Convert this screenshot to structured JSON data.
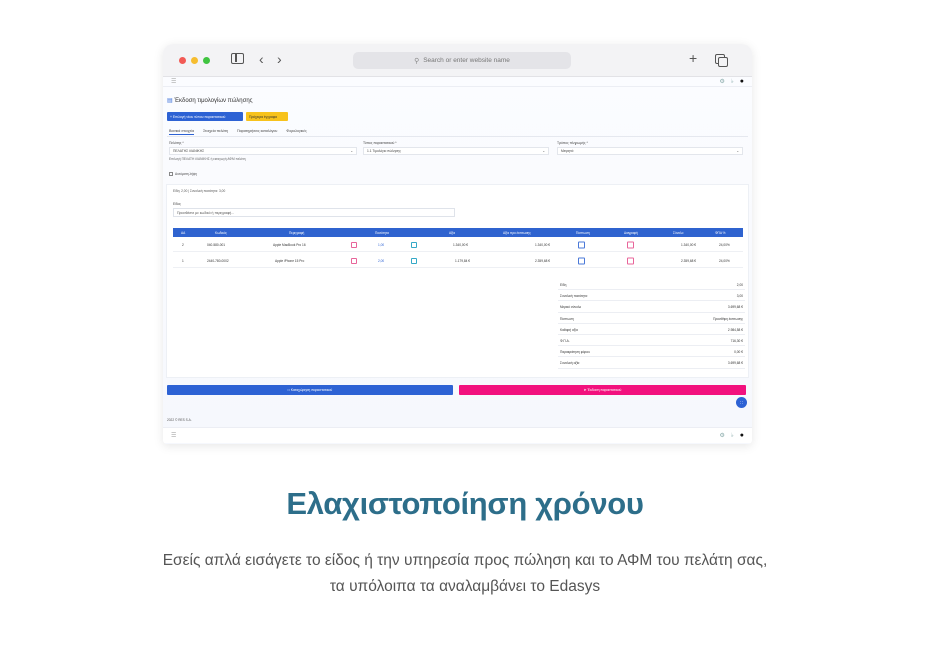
{
  "browser": {
    "url_placeholder": "Search or enter website name",
    "icons": [
      "sidebar-icon",
      "back-icon",
      "forward-icon",
      "search-icon",
      "plus-icon",
      "tabs-icon"
    ]
  },
  "app": {
    "page_title": "Έκδοση τιμολογίων πώλησης",
    "buttons": {
      "primary": "+ Επιλογή νέου τύπου παραστατικού",
      "secondary": "Πρόχειρα έγγραφα"
    },
    "tabs": [
      "Βασικά στοιχεία",
      "Στοιχεία πελάτη",
      "Παρατηρήσεις καταλόγου",
      "Φορολογικές"
    ],
    "fields": [
      {
        "label": "Πελάτης *",
        "value": "ΠΕΛΑΤΗΣ ΛΙΑΝΙΚΗΣ"
      },
      {
        "label": "Τύπος παραστατικού *",
        "value": "1.1 Τιμολόγιο πώλησης"
      },
      {
        "label": "Τρόπος πληρωμής *",
        "value": "Μετρητά"
      }
    ],
    "customer_hint": "Επιλογή ΠΕΛΑΤΗ ΛΙΑΝΙΚΗΣ ή εισαγωγή ΑΦΜ πελάτη",
    "checkbox_label": "Αυτόματη λήψη",
    "totals_line": "Είδη: 2,00 | Συνολική ποσότητα: 3,00",
    "items_label": "Είδος",
    "items_placeholder": "Προσθέστε με κωδικό ή περιγραφή...",
    "table": {
      "headers": [
        "ΑΑ",
        "Κωδικός",
        "Περιγραφή",
        "Ποσότητα",
        "Αξία",
        "Αξία προ έκπτωσης",
        "Έκπτωση",
        "Διαγραφή",
        "Σύνολο",
        "ΦΠΑ %"
      ],
      "rows": [
        {
          "aa": "2",
          "code": "040-580-001",
          "desc": "Apple MacBook Pro 16",
          "qty": "1,00",
          "value": "1.340,00 €",
          "pre": "1.340,00 €",
          "total": "1.340,00 €",
          "vat": "24,00%"
        },
        {
          "aa": "1",
          "code": "2440-780-0002",
          "desc": "Apple iPhone 15 Pro",
          "qty": "2,00",
          "value": "1.179,84 €",
          "pre": "2.359,68 €",
          "total": "2.359,68 €",
          "vat": "24,00%"
        }
      ]
    },
    "summary": [
      {
        "k": "Είδη",
        "v": "2,00"
      },
      {
        "k": "Συνολική ποσότητα",
        "v": "3,00"
      },
      {
        "k": "Μερικό σύνολο",
        "v": "3.699,68 €"
      },
      {
        "k": "Έκπτωση",
        "v": "Προσθήκη έκπτωσης"
      },
      {
        "k": "Καθαρή αξία",
        "v": "2.984,58 €"
      },
      {
        "k": "Φ.Π.Α.",
        "v": "716,30 €"
      },
      {
        "k": "Παρακράτηση φόρου",
        "v": "0,00 €"
      },
      {
        "k": "Συνολική αξία",
        "v": "3.699,68 €"
      }
    ],
    "save_button": "Καταχώρηση παραστατικού",
    "send_button": "Έκδοση παραστατικού",
    "footer": "2022 © RES S.A."
  },
  "marketing": {
    "headline": "Ελαχιστοποίηση χρόνου",
    "line1": "Εσείς απλά εισάγετε το είδος ή την υπηρεσία προς πώληση και το ΑΦΜ του πελάτη σας,",
    "line2": "τα υπόλοιπα τα αναλαμβάνει το Edasys"
  }
}
